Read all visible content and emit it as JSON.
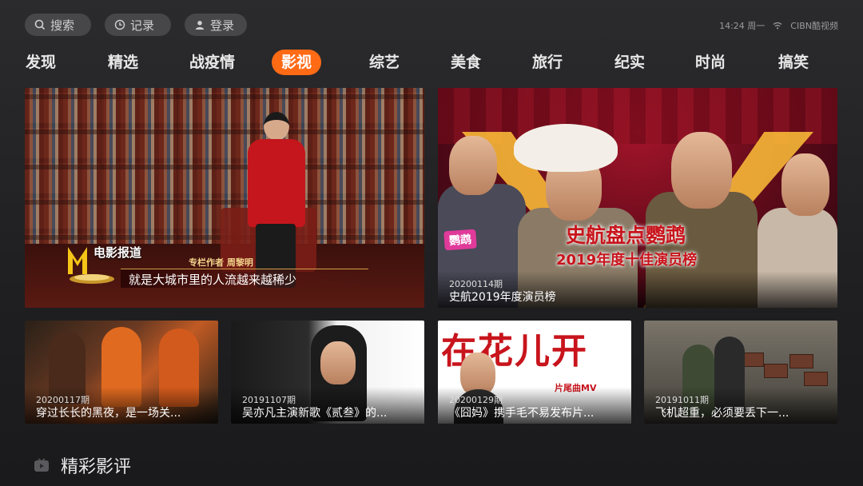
{
  "top_bar": {
    "search_label": "搜索",
    "history_label": "记录",
    "login_label": "登录",
    "time": "14:24 周一",
    "brand": "CIBN酷视频"
  },
  "nav": {
    "items": [
      "发现",
      "精选",
      "战疫情",
      "影视",
      "综艺",
      "美食",
      "旅行",
      "纪实",
      "时尚",
      "搞笑"
    ],
    "active": "影视"
  },
  "featured": [
    {
      "logo_text": "电影报道",
      "overlay_label": "专栏作者 周黎明",
      "subtitle": "就是大城市里的人流越来越稀少"
    },
    {
      "period": "20200114期",
      "title": "史航2019年度演员榜",
      "poster_tag": "鹦鹉",
      "poster_title": "史航盘点鹦鹉",
      "poster_subtitle": "2019年度十佳演员榜"
    }
  ],
  "cards": [
    {
      "period": "20200117期",
      "title": "穿过长长的黑夜，是一场关..."
    },
    {
      "period": "20191107期",
      "title": "吴亦凡主演新歌《贰叁》的..."
    },
    {
      "period": "20200129期",
      "title": "《囧妈》携手毛不易发布片...",
      "poster_text": "在花儿开",
      "poster_tag": "片尾曲MV"
    },
    {
      "period": "20191011期",
      "title": "飞机超重，必须要丢下一..."
    }
  ],
  "section": {
    "title": "精彩影评",
    "icon": "tv-icon"
  },
  "colors": {
    "accent": "#ff6a15",
    "background": "#262628",
    "pill": "#47474a"
  }
}
